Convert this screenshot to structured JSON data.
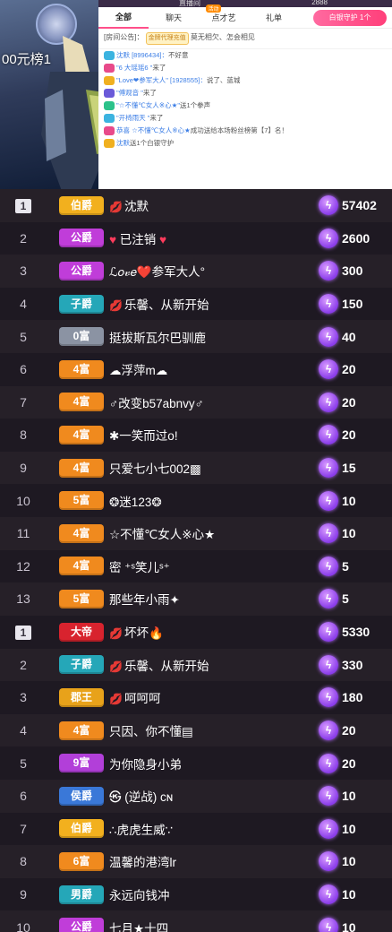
{
  "stage": {
    "rank_text": "00元榜1"
  },
  "panel": {
    "room_no": "直播间",
    "coins": "2888",
    "tabs": [
      "全部",
      "聊天",
      "点才艺",
      "礼单"
    ],
    "hot_badge": "活动",
    "guard_button": "白银守护 1个",
    "notice_prefix": "[房间公告]：",
    "notice_tag": "金牌代理充值",
    "notice_text": "莫无相欠、怎会相见",
    "messages": [
      {
        "name": "沈默 [8996434]：",
        "text": "不好意"
      },
      {
        "name": "\"6 大瑶瑶6 \"",
        "text": "来了"
      },
      {
        "name": "\"Love❤参军大人\" [1928555]：",
        "text": "说了、蓝城"
      },
      {
        "name": "\"傅观音 \"",
        "text": "来了"
      },
      {
        "name": "\"☆不懂℃女人※心★\"",
        "text": "送1个拳声"
      },
      {
        "name": "\"开椅雨天 \"",
        "text": "来了"
      },
      {
        "name": "恭喜 ☆不懂℃女人※心★",
        "text": "成功送给本场粉丝榜第【7】名！"
      },
      {
        "name": "沈默",
        "text": "送1个白银守护"
      }
    ]
  },
  "list1": [
    {
      "rank": "1",
      "level": "伯爵",
      "lvl_color": "#f2b01e",
      "lips": true,
      "name": "沈默",
      "value": "57402"
    },
    {
      "rank": "2",
      "level": "公爵",
      "lvl_color": "#c03dd9",
      "heart": true,
      "name": "已注销",
      "value": "2600"
    },
    {
      "rank": "3",
      "level": "公爵",
      "lvl_color": "#c03dd9",
      "name": "ℒ𝑜𝓋𝑒❤️参军大人°",
      "value": "300"
    },
    {
      "rank": "4",
      "level": "子爵",
      "lvl_color": "#25a7b8",
      "lips": true,
      "name": "乐馨、从新开始",
      "value": "150"
    },
    {
      "rank": "5",
      "level": "0富",
      "lvl_color": "#8b93a3",
      "name": "挺拔斯瓦尔巴驯鹿",
      "value": "40"
    },
    {
      "rank": "6",
      "level": "4富",
      "lvl_color": "#f08a1e",
      "name": "☁浮萍m☁",
      "value": "20"
    },
    {
      "rank": "7",
      "level": "4富",
      "lvl_color": "#f08a1e",
      "name": "♂改变b57abnvy♂",
      "value": "20"
    },
    {
      "rank": "8",
      "level": "4富",
      "lvl_color": "#f08a1e",
      "name": "✱一笑而过o!",
      "value": "20"
    },
    {
      "rank": "9",
      "level": "4富",
      "lvl_color": "#f08a1e",
      "name": "只爱七小七002▩",
      "value": "15"
    },
    {
      "rank": "10",
      "level": "5富",
      "lvl_color": "#f08a1e",
      "name": "❂迷123❂",
      "value": "10"
    },
    {
      "rank": "11",
      "level": "4富",
      "lvl_color": "#f08a1e",
      "name": "☆不懂℃女人※心★",
      "value": "10"
    },
    {
      "rank": "12",
      "level": "4富",
      "lvl_color": "#f08a1e",
      "name": "密 ⁺ˢ笑儿ˢ⁺",
      "value": "5"
    },
    {
      "rank": "13",
      "level": "5富",
      "lvl_color": "#f08a1e",
      "name": "那些年小雨✦",
      "value": "5"
    }
  ],
  "list2": [
    {
      "rank": "1",
      "level": "大帝",
      "lvl_color": "#d8232e",
      "lips": true,
      "name": "坏坏🔥",
      "value": "5330"
    },
    {
      "rank": "2",
      "level": "子爵",
      "lvl_color": "#25a7b8",
      "lips": true,
      "name": "乐馨、从新开始",
      "value": "330"
    },
    {
      "rank": "3",
      "level": "郡王",
      "lvl_color": "#e8a21a",
      "lips": true,
      "name": "呵呵呵",
      "value": "180"
    },
    {
      "rank": "4",
      "level": "4富",
      "lvl_color": "#f08a1e",
      "name": "只因、你不懂▤",
      "value": "20"
    },
    {
      "rank": "5",
      "level": "9富",
      "lvl_color": "#b23fd9",
      "name": "为你隐身小弟",
      "value": "20"
    },
    {
      "rank": "6",
      "level": "侯爵",
      "lvl_color": "#3a78d8",
      "name": "㉿ (逆战) ᴄɴ",
      "value": "10"
    },
    {
      "rank": "7",
      "level": "伯爵",
      "lvl_color": "#f2b01e",
      "name": "∴虎虎生威∵",
      "value": "10"
    },
    {
      "rank": "8",
      "level": "6富",
      "lvl_color": "#f08a1e",
      "name": "温馨的港湾lr",
      "value": "10"
    },
    {
      "rank": "9",
      "level": "男爵",
      "lvl_color": "#25a7b8",
      "name": "永远向钱冲",
      "value": "10"
    },
    {
      "rank": "10",
      "level": "公爵",
      "lvl_color": "#c03dd9",
      "name": "七月★十四",
      "value": "10"
    }
  ],
  "colors": {
    "accent": "#ff4f8a",
    "bg": "#1e1922",
    "coin": "#8a3cea"
  }
}
